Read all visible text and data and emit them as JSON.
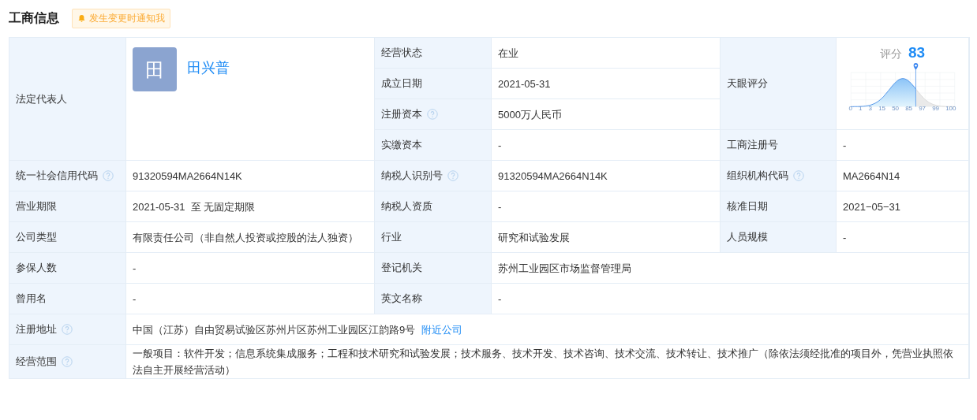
{
  "header": {
    "title": "工商信息",
    "notify_button": "发生变更时通知我"
  },
  "legal_rep": {
    "label": "法定代表人",
    "avatar": "田",
    "name": "田兴普"
  },
  "top_fields": [
    {
      "label": "经营状态",
      "help": false,
      "value": "在业"
    },
    {
      "label": "成立日期",
      "help": false,
      "value": "2021-05-31"
    },
    {
      "label": "注册资本",
      "help": true,
      "value": "5000万人民币"
    },
    {
      "label": "实缴资本",
      "help": false,
      "value": "-"
    }
  ],
  "score": {
    "label": "天眼评分",
    "caption": "评分",
    "value": "83",
    "axis_labels": [
      "0",
      "1",
      "3",
      "15",
      "50",
      "85",
      "97",
      "99",
      "100"
    ]
  },
  "registration_no": {
    "label": "工商注册号",
    "value": "-"
  },
  "rows": [
    [
      {
        "label": "统一社会信用代码",
        "help": true,
        "value": "91320594MA2664N14K"
      },
      {
        "label": "纳税人识别号",
        "help": true,
        "value": "91320594MA2664N14K"
      },
      {
        "label": "组织机构代码",
        "help": true,
        "value": "MA2664N14"
      }
    ],
    [
      {
        "label": "营业期限",
        "help": false,
        "value": "2021-05-31  至 无固定期限"
      },
      {
        "label": "纳税人资质",
        "help": false,
        "value": "-"
      },
      {
        "label": "核准日期",
        "help": false,
        "value": "2021−05−31"
      }
    ],
    [
      {
        "label": "公司类型",
        "help": false,
        "value": "有限责任公司（非自然人投资或控股的法人独资）"
      },
      {
        "label": "行业",
        "help": false,
        "value": "研究和试验发展"
      },
      {
        "label": "人员规模",
        "help": false,
        "value": "-"
      }
    ],
    [
      {
        "label": "参保人数",
        "help": false,
        "value": "-"
      },
      {
        "label": "登记机关",
        "help": false,
        "value": "苏州工业园区市场监督管理局"
      }
    ],
    [
      {
        "label": "曾用名",
        "help": false,
        "value": "-"
      },
      {
        "label": "英文名称",
        "help": false,
        "value": "-"
      }
    ],
    [
      {
        "label": "注册地址",
        "help": true,
        "value": "中国（江苏）自由贸易试验区苏州片区苏州工业园区江韵路9号",
        "link": "附近公司"
      }
    ],
    [
      {
        "label": "经营范围",
        "help": true,
        "value": "一般项目：软件开发；信息系统集成服务；工程和技术研究和试验发展；技术服务、技术开发、技术咨询、技术交流、技术转让、技术推广（除依法须经批准的项目外，凭营业执照依法自主开展经营活动）"
      }
    ]
  ]
}
